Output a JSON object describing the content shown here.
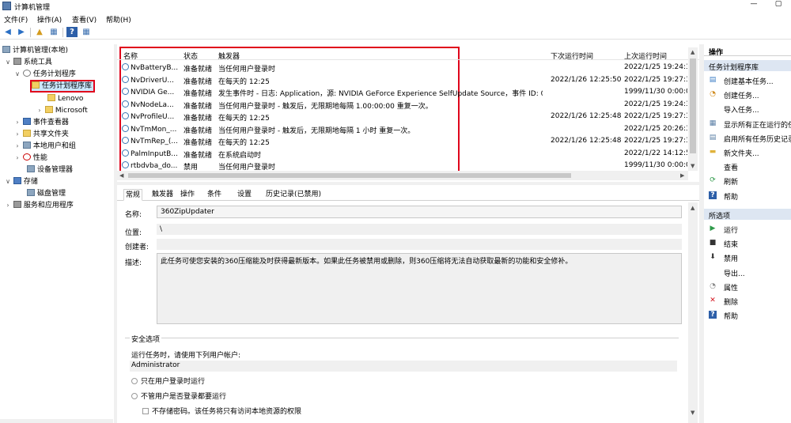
{
  "window": {
    "title": "计算机管理",
    "minimize_glyph": "—",
    "maximize_glyph": "▢"
  },
  "menu": [
    "文件(F)",
    "操作(A)",
    "查看(V)",
    "帮助(H)"
  ],
  "tree": [
    {
      "label": "计算机管理(本地)",
      "toggle": ""
    },
    {
      "label": "系统工具",
      "toggle": "∨"
    },
    {
      "label": "任务计划程序",
      "toggle": "∨"
    },
    {
      "label": "任务计划程序库",
      "toggle": "∨"
    },
    {
      "label": "Lenovo",
      "toggle": ""
    },
    {
      "label": "Microsoft",
      "toggle": "›"
    },
    {
      "label": "事件查看器",
      "toggle": "›"
    },
    {
      "label": "共享文件夹",
      "toggle": "›"
    },
    {
      "label": "本地用户和组",
      "toggle": "›"
    },
    {
      "label": "性能",
      "toggle": "›"
    },
    {
      "label": "设备管理器",
      "toggle": ""
    },
    {
      "label": "存储",
      "toggle": "∨"
    },
    {
      "label": "磁盘管理",
      "toggle": ""
    },
    {
      "label": "服务和应用程序",
      "toggle": "›"
    }
  ],
  "task_list": {
    "columns": [
      "名称",
      "状态",
      "触发器",
      "下次运行时间",
      "上次运行时间"
    ],
    "rows": [
      {
        "name": "NvBatteryB...",
        "status": "准备就绪",
        "trigger": "当任何用户登录时",
        "next": "",
        "last": "2022/1/25 19:24:34"
      },
      {
        "name": "NvDriverU...",
        "status": "准备就绪",
        "trigger": "在每天的 12:25",
        "next": "2022/1/26 12:25:50",
        "last": "2022/1/25 19:27:37"
      },
      {
        "name": "NVIDIA Ge...",
        "status": "准备就绪",
        "trigger": "发生事件时 - 日志: Application，源: NVIDIA GeForce Experience SelfUpdate Source，事件 ID: 0",
        "next": "",
        "last": "1999/11/30 0:00:00"
      },
      {
        "name": "NvNodeLa...",
        "status": "准备就绪",
        "trigger": "当任何用户登录时 - 触发后，无限期地每隔 1.00:00:00 重复一次。",
        "next": "",
        "last": "2022/1/25 19:24:34"
      },
      {
        "name": "NvProfileU...",
        "status": "准备就绪",
        "trigger": "在每天的 12:25",
        "next": "2022/1/26 12:25:48",
        "last": "2022/1/25 19:27:37"
      },
      {
        "name": "NvTmMon_...",
        "status": "准备就绪",
        "trigger": "当任何用户登录时 - 触发后，无限期地每隔 1 小时 重复一次。",
        "next": "",
        "last": "2022/1/25 20:26:34"
      },
      {
        "name": "NvTmRep_(...",
        "status": "准备就绪",
        "trigger": "在每天的 12:25",
        "next": "2022/1/26 12:25:48",
        "last": "2022/1/25 19:27:37"
      },
      {
        "name": "PalmInputB...",
        "status": "准备就绪",
        "trigger": "在系统启动时",
        "next": "",
        "last": "2022/1/22 14:12:53"
      },
      {
        "name": "rtbdvba_do...",
        "status": "禁用",
        "trigger": "当任何用户登录时",
        "next": "",
        "last": "1999/11/30 0:00:00"
      }
    ]
  },
  "tabs": [
    "常规",
    "触发器",
    "操作",
    "条件",
    "设置",
    "历史记录(已禁用)"
  ],
  "detail": {
    "name_label": "名称:",
    "name_value": "360ZipUpdater",
    "location_label": "位置:",
    "location_value": "\\",
    "author_label": "创建者:",
    "author_value": "",
    "desc_label": "描述:",
    "desc_value": "此任务可使您安装的360压缩能及时获得最新版本。如果此任务被禁用或删除，则360压缩将无法自动获取最新的功能和安全修补。",
    "security_title": "安全选项",
    "run_as_label": "运行任务时，请使用下列用户帐户:",
    "run_as_value": "Administrator",
    "opt_logged_on": "只在用户登录时运行",
    "opt_whether": "不管用户是否登录都要运行",
    "opt_no_password": "不存储密码。该任务将只有访问本地资源的权限"
  },
  "actions": {
    "header": "操作",
    "section1": "任务计划程序库",
    "items1": [
      {
        "label": "创建基本任务...",
        "icon": "create-basic-task-icon",
        "glyph": "▤",
        "color": "#3b7dc4"
      },
      {
        "label": "创建任务...",
        "icon": "create-task-icon",
        "glyph": "◔",
        "color": "#d08a1c"
      },
      {
        "label": "导入任务...",
        "icon": "",
        "glyph": "",
        "color": "#000"
      },
      {
        "label": "显示所有正在运行的任务",
        "icon": "running-tasks-icon",
        "glyph": "▦",
        "color": "#5b7fa6"
      },
      {
        "label": "启用所有任务历史记录",
        "icon": "history-icon",
        "glyph": "▤",
        "color": "#5b7fa6"
      },
      {
        "label": "新文件夹...",
        "icon": "new-folder-icon",
        "glyph": "▬",
        "color": "#e0b23a"
      },
      {
        "label": "查看",
        "icon": "",
        "glyph": "",
        "color": "#000"
      },
      {
        "label": "刷新",
        "icon": "refresh-icon",
        "glyph": "⟳",
        "color": "#2f9a4a"
      },
      {
        "label": "帮助",
        "icon": "help-icon",
        "glyph": "?",
        "color": "#fff"
      }
    ],
    "section2": "所选项",
    "items2": [
      {
        "label": "运行",
        "icon": "run-icon",
        "glyph": "▶",
        "color": "#2f9a4a"
      },
      {
        "label": "结束",
        "icon": "end-icon",
        "glyph": "■",
        "color": "#333"
      },
      {
        "label": "禁用",
        "icon": "disable-icon",
        "glyph": "⬇",
        "color": "#333"
      },
      {
        "label": "导出...",
        "icon": "",
        "glyph": "",
        "color": "#000"
      },
      {
        "label": "属性",
        "icon": "properties-icon",
        "glyph": "◔",
        "color": "#888"
      },
      {
        "label": "删除",
        "icon": "delete-icon",
        "glyph": "✕",
        "color": "#d4141e"
      },
      {
        "label": "帮助",
        "icon": "help-icon",
        "glyph": "?",
        "color": "#fff"
      }
    ]
  },
  "colors": {
    "highlight": "#e0001b",
    "selection": "#cce8ff",
    "section": "#dde6f2"
  }
}
